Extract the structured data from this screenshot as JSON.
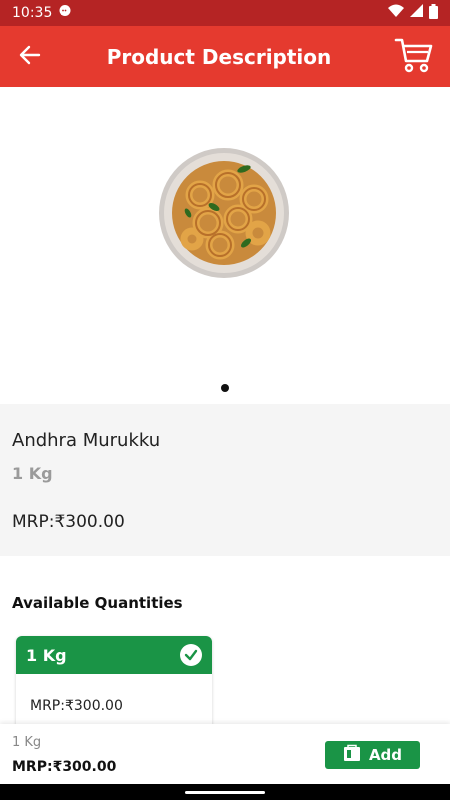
{
  "status_bar": {
    "time": "10:35",
    "icons": [
      "chat-bubble-icon",
      "wifi-icon",
      "signal-icon",
      "battery-icon"
    ]
  },
  "app_bar": {
    "title": "Product Description",
    "back_icon": "arrow-left-icon",
    "cart_icon": "cart-icon",
    "color": "#e53a2f"
  },
  "gallery": {
    "image_name": "murukku-bowl-image",
    "page_count": 1,
    "active_page": 1
  },
  "product": {
    "name": "Andhra Murukku",
    "weight": "1 Kg",
    "mrp": "MRP:₹300.00"
  },
  "quantities": {
    "heading": "Available Quantities",
    "options": [
      {
        "label": "1 Kg",
        "mrp": "MRP:₹300.00",
        "selected": true
      }
    ]
  },
  "bottom_bar": {
    "weight": "1 Kg",
    "mrp": "MRP:₹300.00",
    "add_label": "Add",
    "accent": "#1a9446"
  }
}
